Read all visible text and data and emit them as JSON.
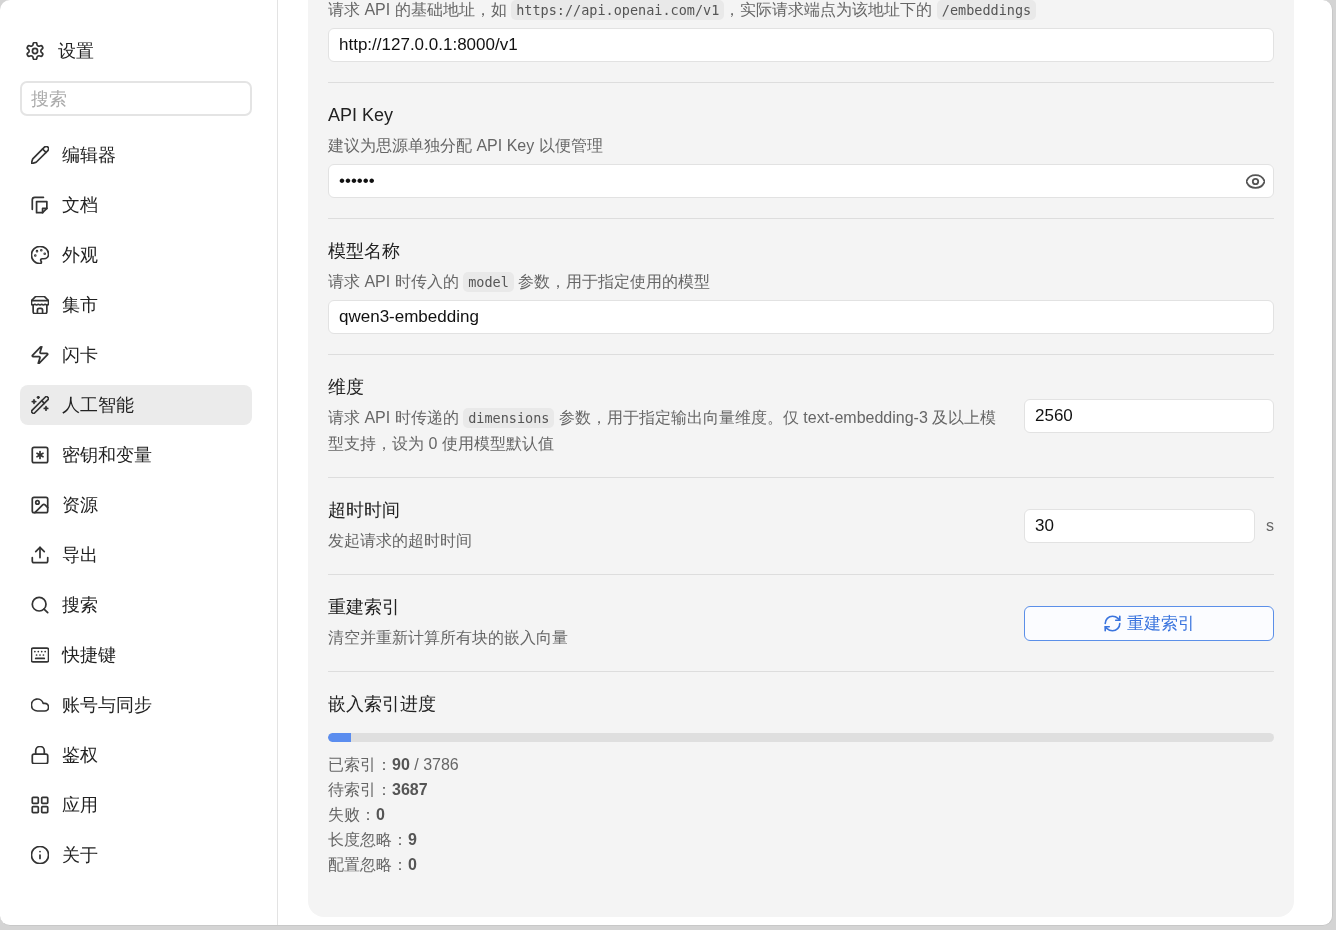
{
  "sidebar": {
    "title": "设置",
    "search": {
      "placeholder": "搜索"
    },
    "items": [
      {
        "label": "编辑器",
        "selected": false
      },
      {
        "label": "文档",
        "selected": false
      },
      {
        "label": "外观",
        "selected": false
      },
      {
        "label": "集市",
        "selected": false
      },
      {
        "label": "闪卡",
        "selected": false
      },
      {
        "label": "人工智能",
        "selected": true
      },
      {
        "label": "密钥和变量",
        "selected": false
      },
      {
        "label": "资源",
        "selected": false
      },
      {
        "label": "导出",
        "selected": false
      },
      {
        "label": "搜索",
        "selected": false
      },
      {
        "label": "快捷键",
        "selected": false
      },
      {
        "label": "账号与同步",
        "selected": false
      },
      {
        "label": "鉴权",
        "selected": false
      },
      {
        "label": "应用",
        "selected": false
      },
      {
        "label": "关于",
        "selected": false
      }
    ]
  },
  "sections": [
    {
      "kind": "stacked",
      "description": [
        {
          "kind": "text",
          "text": "请求 API 的基础地址，如 "
        },
        {
          "kind": "code",
          "text": "https://api.openai.com/v1"
        },
        {
          "kind": "text",
          "text": "，实际请求端点为该地址下的 "
        },
        {
          "kind": "code",
          "text": "/embeddings"
        }
      ],
      "field": {
        "kind": "text",
        "value": "http://127.0.0.1:8000/v1"
      }
    },
    {
      "kind": "stacked",
      "title": "API Key",
      "description": [
        {
          "kind": "text",
          "text": "建议为思源单独分配 API Key 以便管理"
        }
      ],
      "field": {
        "kind": "password",
        "value": "••••••"
      }
    },
    {
      "kind": "stacked",
      "title": "模型名称",
      "description": [
        {
          "kind": "text",
          "text": "请求 API 时传入的 "
        },
        {
          "kind": "code",
          "text": "model"
        },
        {
          "kind": "text",
          "text": " 参数，用于指定使用的模型"
        }
      ],
      "field": {
        "kind": "text",
        "value": "qwen3-embedding"
      }
    },
    {
      "kind": "inline",
      "title": "维度",
      "description": [
        {
          "kind": "text",
          "text": "请求 API 时传递的 "
        },
        {
          "kind": "code",
          "text": "dimensions"
        },
        {
          "kind": "text",
          "text": " 参数，用于指定输出向量维度。仅 text-embedding-3 及以上模型支持，设为 0 使用模型默认值"
        }
      ],
      "field": {
        "kind": "text",
        "value": "2560"
      }
    },
    {
      "kind": "inline",
      "title": "超时时间",
      "description": [
        {
          "kind": "text",
          "text": "发起请求的超时时间"
        }
      ],
      "field": {
        "kind": "number",
        "value": "30",
        "unit": "s"
      }
    },
    {
      "kind": "inline",
      "title": "重建索引",
      "description": [
        {
          "kind": "text",
          "text": "清空并重新计算所有块的嵌入向量"
        }
      ],
      "button": {
        "label": "重建索引"
      }
    },
    {
      "kind": "progress",
      "title": "嵌入索引进度",
      "level": 0.024,
      "stats": [
        "已索引：**90** / 3786",
        "待索引：**3687**",
        "失败：**0**",
        "长度忽略：**9**",
        "配置忽略：**0**"
      ]
    }
  ]
}
